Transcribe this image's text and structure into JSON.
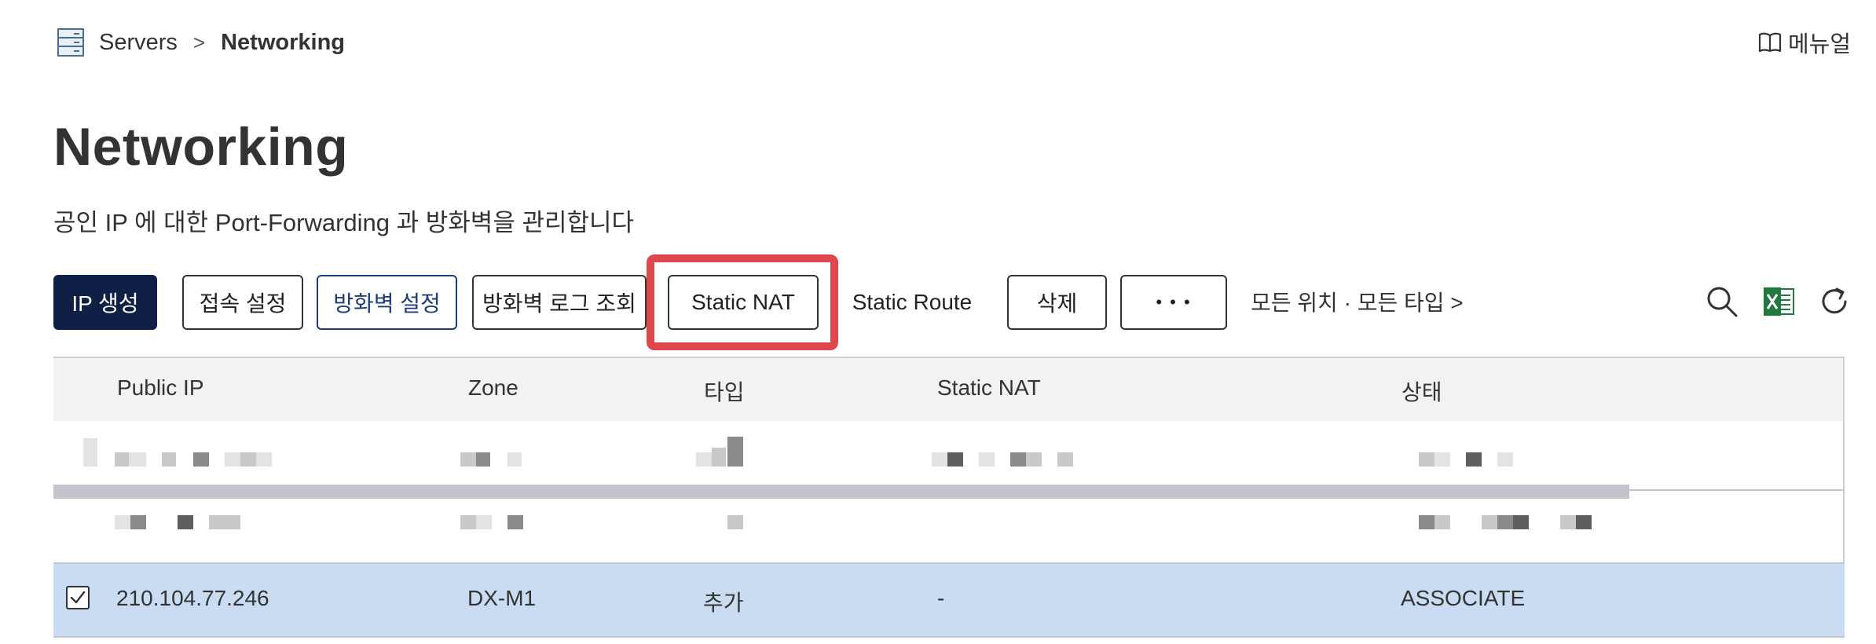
{
  "breadcrumb": {
    "parent": "Servers",
    "separator": ">",
    "current": "Networking"
  },
  "manual_label": "메뉴얼",
  "page": {
    "title": "Networking",
    "subtitle": "공인 IP 에 대한 Port-Forwarding 과 방화벽을 관리합니다"
  },
  "toolbar": {
    "create_ip": "IP 생성",
    "access_settings": "접속 설정",
    "firewall_settings": "방화벽 설정",
    "firewall_log": "방화벽 로그 조회",
    "static_nat": "Static NAT",
    "static_route": "Static Route",
    "delete": "삭제",
    "more": "• • •",
    "filter": "모든 위치 · 모든 타입 >"
  },
  "table": {
    "columns": [
      "Public IP",
      "Zone",
      "타입",
      "Static NAT",
      "상태"
    ],
    "selected_row": {
      "public_ip": "210.104.77.246",
      "zone": "DX-M1",
      "type": "추가",
      "static_nat": "-",
      "status": "ASSOCIATE"
    }
  },
  "icons": {
    "breadcrumb": "server-icon",
    "manual": "book-icon",
    "search": "search-icon",
    "excel": "excel-icon",
    "refresh": "refresh-icon",
    "checkbox": "check-icon"
  },
  "colors": {
    "primary": "#0f1f45",
    "accent_blue": "#1c3e78",
    "highlight": "#e0474c",
    "selected_row": "#c9dcf1",
    "excel_green": "#1f7a3f"
  }
}
